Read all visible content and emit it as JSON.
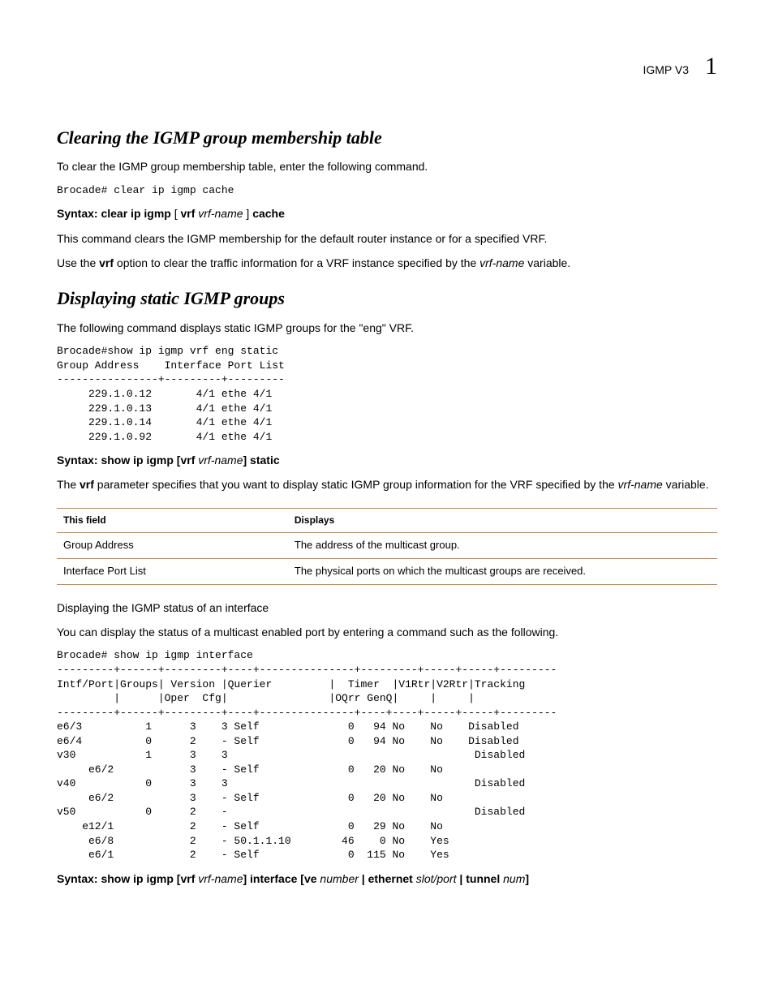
{
  "header": {
    "topic": "IGMP V3",
    "chapter": "1"
  },
  "section1": {
    "title": "Clearing the IGMP group membership table",
    "intro": "To clear the IGMP group membership table, enter the following command.",
    "code": "Brocade# clear ip igmp cache",
    "syntax_label": "Syntax:",
    "syntax_cmd_1": "clear ip igmp",
    "syntax_bracket_open": " [ ",
    "syntax_vrf": "vrf",
    "syntax_vrfname": "vrf-name",
    "syntax_bracket_close": " ] ",
    "syntax_cache": "cache",
    "p1": "This command clears the IGMP membership for the default router instance or for a specified VRF.",
    "p2_a": "Use the ",
    "p2_vrf": "vrf",
    "p2_b": " option to clear the traffic information for a VRF instance specified by the ",
    "p2_vrfname": "vrf-name",
    "p2_c": " variable."
  },
  "section2": {
    "title": "Displaying static IGMP groups",
    "intro": "The following command displays static IGMP groups for the \"eng\" VRF.",
    "code": "Brocade#show ip igmp vrf eng static\nGroup Address    Interface Port List\n----------------+---------+---------\n     229.1.0.12       4/1 ethe 4/1\n     229.1.0.13       4/1 ethe 4/1\n     229.1.0.14       4/1 ethe 4/1\n     229.1.0.92       4/1 ethe 4/1",
    "syntax_label": "Syntax:",
    "syntax_a": "show ip igmp",
    "syntax_b": "  [vrf ",
    "syntax_vrfname": "vrf-name",
    "syntax_c": "]  static",
    "p1_a": "The ",
    "p1_vrf": "vrf",
    "p1_b": " parameter specifies that you want to display static IGMP group information for the VRF specified by the ",
    "p1_vrfname": "vrf-name",
    "p1_c": " variable.",
    "table": {
      "h1": "This field",
      "h2": "Displays",
      "rows": [
        {
          "c1": "Group Address",
          "c2": "The address of the multicast group."
        },
        {
          "c1": "Interface Port List",
          "c2": "The physical ports on which the multicast groups are received."
        }
      ]
    },
    "p2": "Displaying the IGMP status of an interface",
    "p3": "You can display the status of a multicast enabled port by entering a command such as the following.",
    "code2": "Brocade# show ip igmp interface\n---------+------+---------+----+---------------+---------+-----+-----+---------\nIntf/Port|Groups| Version |Querier         |  Timer  |V1Rtr|V2Rtr|Tracking\n         |      |Oper  Cfg|                |OQrr GenQ|     |     |\n---------+------+---------+----+---------------+----+----+-----+-----+---------\ne6/3          1      3    3 Self              0   94 No    No    Disabled\ne6/4          0      2    - Self              0   94 No    No    Disabled\nv30           1      3    3                                       Disabled\n     e6/2            3    - Self              0   20 No    No\nv40           0      3    3                                       Disabled\n     e6/2            3    - Self              0   20 No    No\nv50           0      2    -                                       Disabled\n    e12/1            2    - Self              0   29 No    No\n     e6/8            2    - 50.1.1.10        46    0 No    Yes\n     e6/1            2    - Self              0  115 No    Yes",
    "syntax3": {
      "label": "Syntax:",
      "a": "show ip igmp [vrf ",
      "vrfname": "vrf-name",
      "b": "]  interface [ve ",
      "number": "number",
      "c": " | ethernet ",
      "slotport": "slot/port",
      "d": "  | tunnel ",
      "num": "num",
      "e": "]"
    }
  },
  "chart_data": {
    "type": "table",
    "title": "Static IGMP group field descriptions",
    "columns": [
      "This field",
      "Displays"
    ],
    "rows": [
      [
        "Group Address",
        "The address of the multicast group."
      ],
      [
        "Interface Port List",
        "The physical ports on which the multicast groups are received."
      ]
    ]
  }
}
